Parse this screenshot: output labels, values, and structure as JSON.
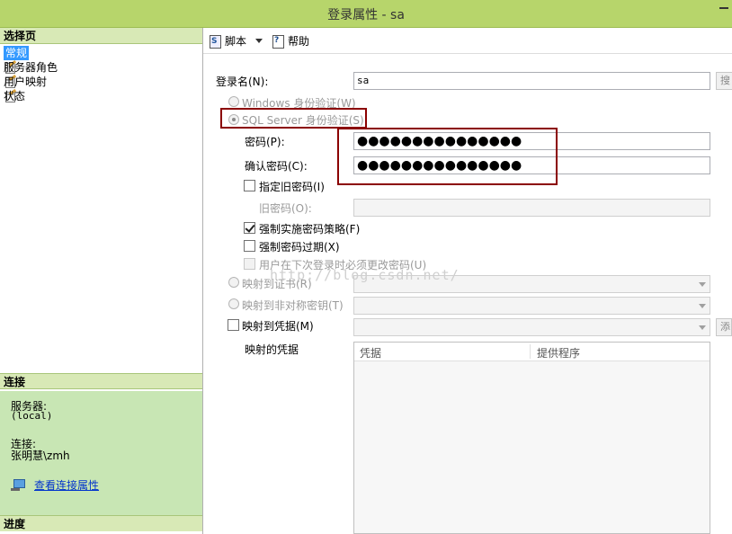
{
  "window": {
    "title": "登录属性 - sa"
  },
  "left": {
    "select_header": "选择页",
    "pages": [
      {
        "label": "常规",
        "selected": true
      },
      {
        "label": "服务器角色",
        "selected": false
      },
      {
        "label": "用户映射",
        "selected": false
      },
      {
        "label": "状态",
        "selected": false
      }
    ],
    "connection_header": "连接",
    "server_label": "服务器:",
    "server_value": "(local)",
    "connection_label": "连接:",
    "connection_value": "张明慧\\zmh",
    "view_conn_props": "查看连接属性",
    "progress_header": "进度"
  },
  "toolbar": {
    "script_label": "脚本",
    "help_label": "帮助"
  },
  "form": {
    "login_name_label": "登录名(N):",
    "login_name_value": "sa",
    "search_label": "搜",
    "windows_auth_label": "Windows 身份验证(W)",
    "sql_auth_label": "SQL Server 身份验证(S)",
    "password_label": "密码(P):",
    "password_value": "●●●●●●●●●●●●●●●",
    "confirm_label": "确认密码(C):",
    "confirm_value": "●●●●●●●●●●●●●●●",
    "specify_old_label": "指定旧密码(I)",
    "old_password_label": "旧密码(O):",
    "enforce_policy_label": "强制实施密码策略(F)",
    "enforce_policy_checked": true,
    "enforce_expiration_label": "强制密码过期(X)",
    "must_change_label": "用户在下次登录时必须更改密码(U)",
    "map_cert_label": "映射到证书(R)",
    "map_asym_label": "映射到非对称密钥(T)",
    "map_cred_label": "映射到凭据(M)",
    "add_label": "添",
    "mapped_creds_label": "映射的凭据",
    "grid_col_cred": "凭据",
    "grid_col_provider": "提供程序",
    "watermark": "http://blog.csdn.net/"
  }
}
